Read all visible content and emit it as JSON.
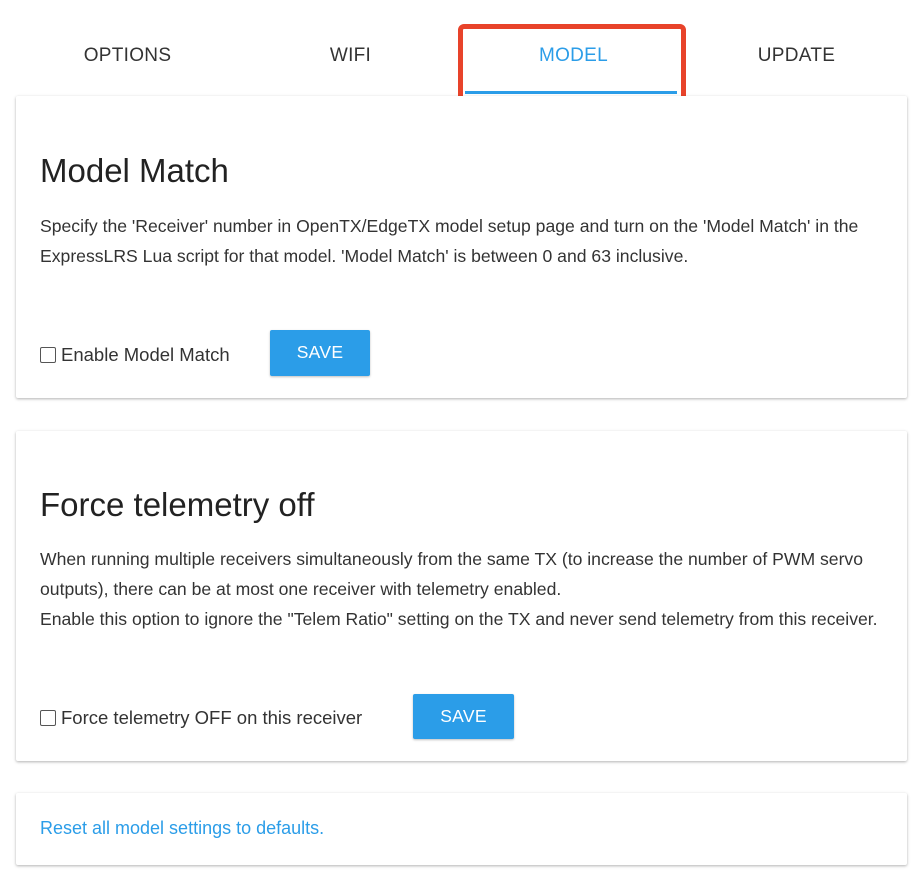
{
  "tabs": [
    {
      "label": "OPTIONS"
    },
    {
      "label": "WIFI"
    },
    {
      "label": "MODEL"
    },
    {
      "label": "UPDATE"
    }
  ],
  "active_tab": "MODEL",
  "model_match": {
    "title": "Model Match",
    "description": "Specify the 'Receiver' number in OpenTX/EdgeTX model setup page and turn on the 'Model Match' in the ExpressLRS Lua script for that model. 'Model Match' is between 0 and 63 inclusive.",
    "checkbox_label": "Enable Model Match",
    "checked": false,
    "save_label": "SAVE"
  },
  "force_telemetry": {
    "title": "Force telemetry off",
    "description_line1": "When running multiple receivers simultaneously from the same TX (to increase the number of PWM servo outputs), there can be at most one receiver with telemetry enabled.",
    "description_line2": "Enable this option to ignore the \"Telem Ratio\" setting on the TX and never send telemetry from this receiver.",
    "checkbox_label": "Force telemetry OFF on this receiver",
    "checked": false,
    "save_label": "SAVE"
  },
  "reset": {
    "link_text": "Reset all model settings to defaults."
  },
  "colors": {
    "accent": "#2b9de8",
    "highlight": "#e8432a"
  }
}
